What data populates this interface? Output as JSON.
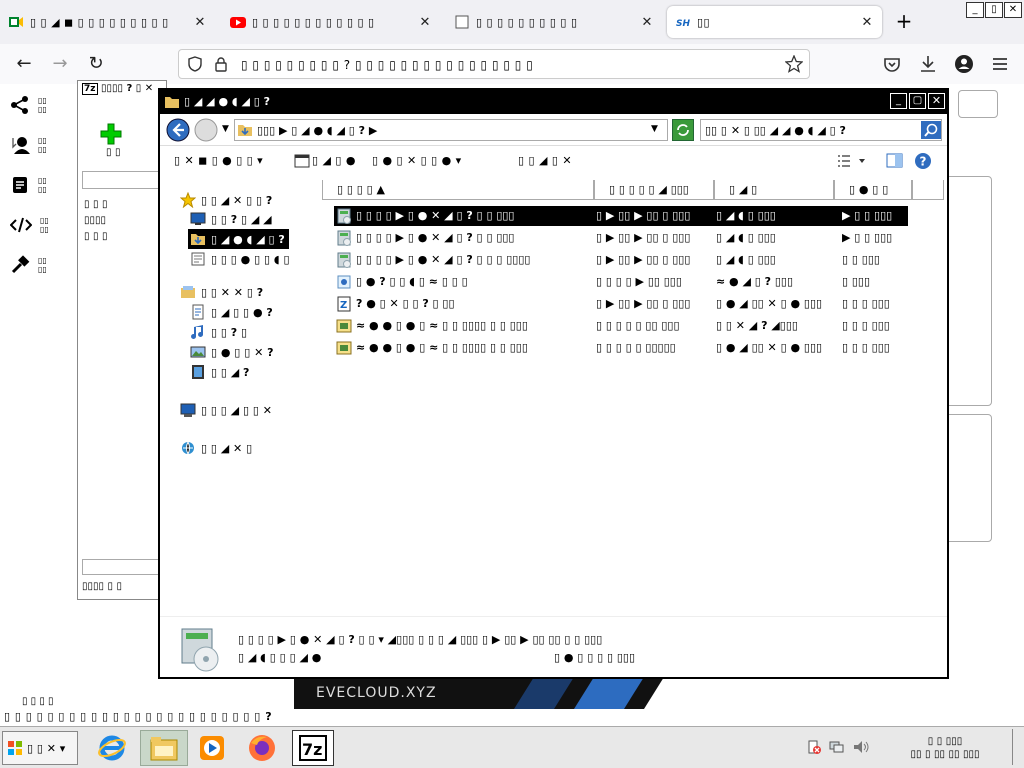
{
  "browser": {
    "tabs": [
      {
        "title": "▯ ▯ ◢ ◼ ▯ ▯ ▯ ▯ ▯ ▯ ▯ ▯ ▯",
        "favicon": "meet-icon",
        "active": false
      },
      {
        "title": "▯ ▯ ▯ ▯ ▯ ▯ ▯ ▯ ▯ ▯ ▯ ▯",
        "favicon": "youtube-icon",
        "active": false
      },
      {
        "title": "▯ ▯ ▯ ▯ ▯ ▯ ▯ ▯ ▯ ▯",
        "favicon": "generic-icon",
        "active": false
      },
      {
        "title": "▯▯",
        "favicon": "sh-icon",
        "active": true
      }
    ],
    "url": "▯ ▯ ▯ ▯ ▯ ▯ ▯ ▯ ▯ ? ▯ ▯ ▯ ▯ ▯ ▯ ▯ ▯ ▯ ▯ ▯ ▯ ▯ ▯ ▯ ▯",
    "new_tab_label": "+",
    "win_controls": [
      "_",
      "▯",
      "✕"
    ]
  },
  "page": {
    "sidebar": [
      {
        "icon": "share-icon",
        "label": "▯▯ ▯▯"
      },
      {
        "icon": "group-icon",
        "label": "▯▯ ▯▯"
      },
      {
        "icon": "doc-icon",
        "label": "▯▯ ▯▯"
      },
      {
        "icon": "code-icon",
        "label": "▯▯ ▯▯"
      },
      {
        "icon": "hammer-icon",
        "label": "▯▯ ▯▯"
      }
    ],
    "banner_text": "EVECLOUD.XYZ",
    "footer_text": "▯ ▯ ▯ ▯ ▯ ▯ ▯ ▯ ▯ ▯ ▯ ▯ ▯ ▯ ▯ ▯ ▯ ▯ ▯ ▯ ▯ ▯ ▯ ▯ ?",
    "footer_small": "▯ ▯ ▯ ▯"
  },
  "zip": {
    "title": "▯▯▯▯ ? ▯ ✕",
    "add_label": "▯ ▯",
    "items": [
      "▯ ▯ ▯",
      "▯▯▯▯",
      "▯ ▯ ▯"
    ],
    "status": "▯▯▯▯ ▯ ▯"
  },
  "explorer": {
    "title": "▯ ◢ ◢ ● ◖ ◢ ▯ ?",
    "address": "▯▯▯ ▶ ▯ ◢ ● ◖ ◢ ▯ ? ▶",
    "search": "▯▯ ▯ ✕ ▯ ▯▯ ◢ ◢ ● ◖ ◢ ▯ ?",
    "commands": [
      "▯ ✕ ◼ ▯ ● ▯ ▯ ▾",
      "▯ ◢ ▯ ●",
      "▯ ● ▯ ✕ ▯ ▯ ● ▾",
      "▯ ▯ ◢ ▯ ✕"
    ],
    "nav": [
      {
        "label": "▯ ▯ ◢ ✕ ▯ ▯ ?",
        "icon": "star-icon",
        "level": 0
      },
      {
        "label": "▯ ▯ ? ▯ ◢ ◢",
        "icon": "desktop-icon",
        "level": 1
      },
      {
        "label": "▯ ◢ ● ◖ ◢ ▯ ?",
        "icon": "downloads-icon",
        "level": 1,
        "selected": true
      },
      {
        "label": "▯ ▯ ▯ ● ▯ ▯ ◖ ▯",
        "icon": "recent-icon",
        "level": 1
      },
      {
        "label": "▯ ▯ ✕ ✕ ▯ ?",
        "icon": "libraries-icon",
        "level": 0
      },
      {
        "label": "▯ ◢ ▯ ▯ ● ?",
        "icon": "documents-icon",
        "level": 1
      },
      {
        "label": "▯ ▯ ? ▯",
        "icon": "music-icon",
        "level": 1
      },
      {
        "label": "▯ ● ▯ ▯ ✕ ?",
        "icon": "pictures-icon",
        "level": 1
      },
      {
        "label": "▯ ▯ ◢ ?",
        "icon": "videos-icon",
        "level": 1
      },
      {
        "label": "▯ ▯ ▯ ◢ ▯ ▯ ✕",
        "icon": "computer-icon",
        "level": 0
      },
      {
        "label": "▯ ▯ ◢ ✕ ▯",
        "icon": "network-icon",
        "level": 0
      }
    ],
    "columns": [
      "▯ ▯ ▯ ▯ ▲",
      "▯ ▯ ▯ ▯ ▯ ◢ ▯▯▯",
      "▯ ◢ ▯",
      "▯ ● ▯ ▯"
    ],
    "files": [
      {
        "icon": "setup-icon",
        "name": "▯ ▯ ▯ ▯ ▶ ▯ ● ✕ ◢ ▯ ? ▯ ▯ ▯▯▯",
        "date": "▯ ▶ ▯▯ ▶ ▯▯ ▯ ▯▯▯",
        "type": "▯ ◢ ◖ ▯ ▯▯▯",
        "size": "▶ ▯ ▯ ▯▯▯",
        "selected": true
      },
      {
        "icon": "setup-icon",
        "name": "▯ ▯ ▯ ▯ ▶ ▯ ● ✕ ◢ ▯ ? ▯ ▯ ▯▯▯",
        "date": "▯ ▶ ▯▯ ▶ ▯▯ ▯ ▯▯▯",
        "type": "▯ ◢ ◖ ▯ ▯▯▯",
        "size": "▶ ▯ ▯ ▯▯▯"
      },
      {
        "icon": "setup-icon",
        "name": "▯ ▯ ▯ ▯ ▶ ▯ ● ✕ ◢ ▯ ? ▯ ▯ ▯ ▯▯▯▯",
        "date": "▯ ▶ ▯▯ ▶ ▯▯ ▯ ▯▯▯",
        "type": "▯ ◢ ◖ ▯ ▯▯▯",
        "size": "▯ ▯ ▯▯▯"
      },
      {
        "icon": "installer-icon",
        "name": "▯ ● ? ▯ ▯ ◖ ▯ ≈ ▯ ▯ ▯",
        "date": "▯ ▯ ▯ ▯ ▶ ▯▯ ▯▯▯",
        "type": "≈ ● ◢ ▯ ? ▯▯▯",
        "size": "▯ ▯▯▯"
      },
      {
        "icon": "zip-icon",
        "name": "? ● ▯ ✕ ▯ ▯ ? ▯ ▯▯",
        "date": "▯ ▶ ▯▯ ▶ ▯▯ ▯ ▯▯▯",
        "type": "▯ ● ◢ ▯▯ ✕ ▯ ● ▯▯▯",
        "size": "▯ ▯ ▯ ▯▯▯"
      },
      {
        "icon": "archive-icon",
        "name": "≈ ● ● ▯ ● ▯ ≈ ▯ ▯ ▯▯▯▯ ▯ ▯ ▯▯▯",
        "date": "▯ ▯ ▯ ▯ ▯ ▯▯ ▯▯▯",
        "type": "▯ ▯ ✕ ◢ ? ◢▯▯▯",
        "size": "▯ ▯ ▯ ▯▯▯"
      },
      {
        "icon": "archive-icon",
        "name": "≈ ● ● ▯ ● ▯ ≈ ▯ ▯ ▯▯▯▯ ▯ ▯ ▯▯▯",
        "date": "▯ ▯ ▯ ▯ ▯ ▯▯▯▯▯",
        "type": "▯ ● ◢ ▯▯ ✕ ▯ ● ▯▯▯",
        "size": "▯ ▯ ▯ ▯▯▯"
      }
    ],
    "details": {
      "line1": "▯ ▯ ▯ ▯ ▶ ▯ ● ✕ ◢ ▯ ? ▯ ▯ ▾ ◢▯▯▯ ▯ ▯ ▯ ◢ ▯▯▯ ▯ ▶ ▯▯ ▶ ▯▯ ▯▯ ▯ ▯ ▯▯▯",
      "line2": "▯ ◢ ◖ ▯ ▯ ▯ ◢ ●",
      "line2b": "▯ ● ▯ ▯ ▯ ▯ ▯▯▯"
    }
  },
  "taskbar": {
    "start_label": "▯ ▯ ✕ ▾",
    "apps": [
      "ie-icon",
      "explorer-icon",
      "media-player-icon",
      "firefox-icon",
      "7zip-icon"
    ],
    "clock_line1": "▯ ▯ ▯▯▯",
    "clock_line2": "▯▯ ▯ ▯▯ ▯▯ ▯▯▯",
    "tray": [
      "action-center-icon",
      "network-tray-icon",
      "volume-icon"
    ]
  }
}
